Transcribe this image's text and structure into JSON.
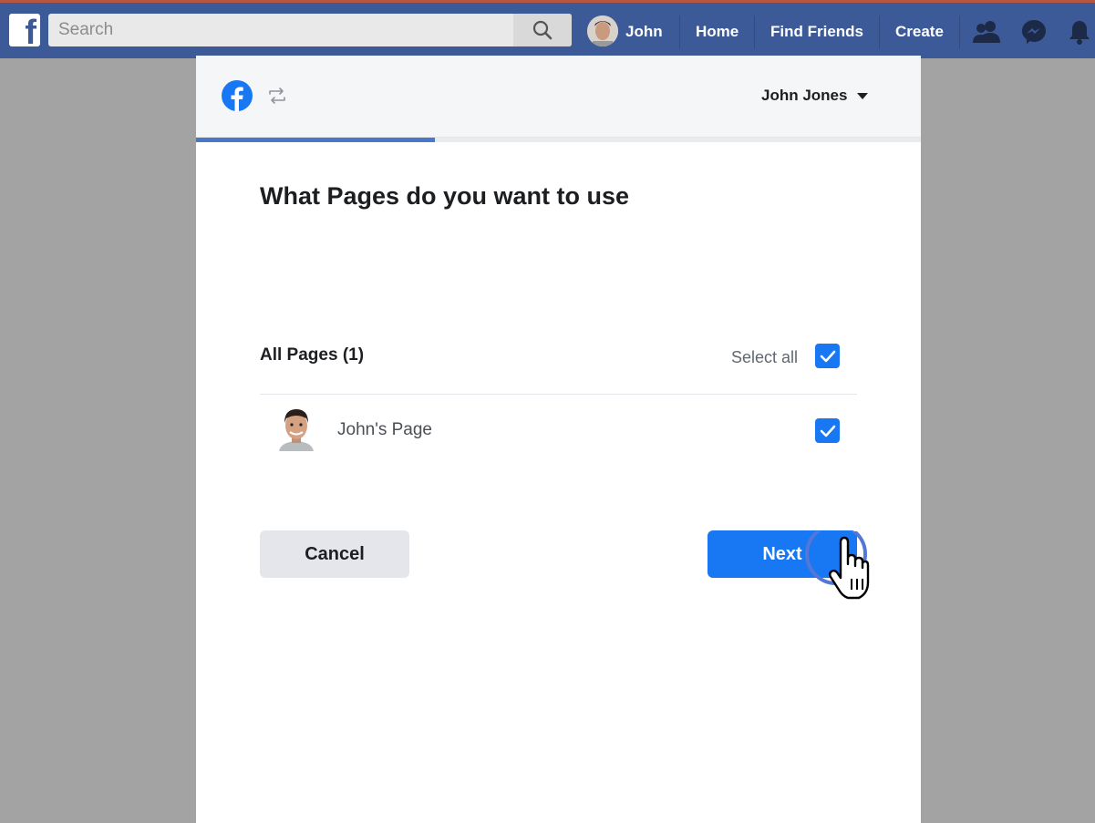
{
  "topbar": {
    "logo_letter": "f",
    "search_placeholder": "Search",
    "profile_name": "John",
    "nav": [
      "Home",
      "Find Friends",
      "Create"
    ],
    "icons": [
      "friends-icon",
      "messenger-icon",
      "notifications-icon"
    ]
  },
  "dialog": {
    "account_name": "John Jones",
    "progress_percent": 33,
    "title": "What Pages do you want to use",
    "section_label": "All Pages (1)",
    "select_all_label": "Select all",
    "select_all_checked": true,
    "pages": [
      {
        "name": "John's Page",
        "checked": true
      }
    ],
    "cancel_label": "Cancel",
    "next_label": "Next"
  },
  "colors": {
    "nav_blue": "#3d5a98",
    "primary_blue": "#1877f2",
    "progress_blue": "#4a78c9"
  }
}
